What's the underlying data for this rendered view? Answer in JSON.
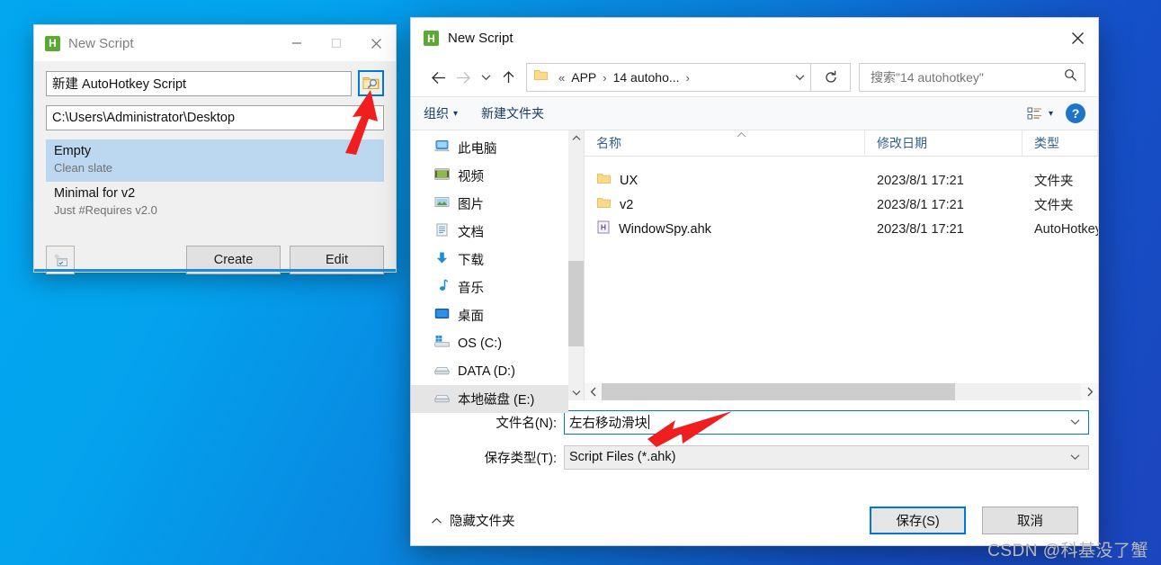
{
  "desktop": {
    "watermark": "CSDN @科基没了蟹"
  },
  "script_window": {
    "title": "New Script",
    "app_icon": "H",
    "caption": {
      "minimize": "minimize-icon",
      "maximize": "maximize-icon",
      "close": "close-icon"
    },
    "name_field": {
      "value": "新建 AutoHotkey Script"
    },
    "browse_button": {
      "icon": "folder-search-icon"
    },
    "path_field": {
      "value": "C:\\Users\\Administrator\\Desktop"
    },
    "templates": [
      {
        "title": "Empty",
        "subtitle": "Clean slate",
        "selected": true
      },
      {
        "title": "Minimal for v2",
        "subtitle": "Just #Requires v2.0",
        "selected": false
      }
    ],
    "small_button": {
      "icon": "script-window-icon"
    },
    "create_button": "Create",
    "edit_button": "Edit"
  },
  "save_dialog": {
    "title": "New Script",
    "app_icon": "H",
    "close_button": "close-icon",
    "nav": {
      "back": "back-arrow-icon",
      "forward": "forward-arrow-icon",
      "recent": "chevron-down-icon",
      "up": "up-arrow-icon",
      "breadcrumb": {
        "overflow": "«",
        "segments": [
          "APP",
          "14 autoho..."
        ],
        "separator": "›",
        "dropdown": "chevron-down-icon"
      },
      "refresh": "refresh-icon",
      "search": {
        "placeholder": "搜索\"14 autohotkey\"",
        "value": "",
        "icon": "search-icon"
      }
    },
    "command_bar": {
      "organize": "组织",
      "organize_caret": "▾",
      "new_folder": "新建文件夹",
      "view_icon": "list-view-icon",
      "view_caret": "▾",
      "help": "?"
    },
    "tree": [
      {
        "label": "此电脑",
        "icon": "computer-icon",
        "selected": false
      },
      {
        "label": "视频",
        "icon": "videos-icon",
        "selected": false
      },
      {
        "label": "图片",
        "icon": "pictures-icon",
        "selected": false
      },
      {
        "label": "文档",
        "icon": "documents-icon",
        "selected": false
      },
      {
        "label": "下载",
        "icon": "downloads-icon",
        "selected": false
      },
      {
        "label": "音乐",
        "icon": "music-icon",
        "selected": false
      },
      {
        "label": "桌面",
        "icon": "desktop-icon",
        "selected": false
      },
      {
        "label": "OS (C:)",
        "icon": "windows-drive-icon",
        "selected": false
      },
      {
        "label": "DATA (D:)",
        "icon": "drive-icon",
        "selected": false
      },
      {
        "label": "本地磁盘 (E:)",
        "icon": "drive-icon",
        "selected": true
      }
    ],
    "columns": [
      "名称",
      "修改日期",
      "类型"
    ],
    "files": [
      {
        "name": "UX",
        "icon": "folder-icon",
        "modified": "2023/8/1 17:21",
        "type": "文件夹"
      },
      {
        "name": "v2",
        "icon": "folder-icon",
        "modified": "2023/8/1 17:21",
        "type": "文件夹"
      },
      {
        "name": "WindowSpy.ahk",
        "icon": "ahk-file-icon",
        "modified": "2023/8/1 17:21",
        "type": "AutoHotkey Script"
      }
    ],
    "filename": {
      "label": "文件名(N):",
      "mnemonic": "N",
      "value": "左右移动滑块"
    },
    "filetype": {
      "label": "保存类型(T):",
      "mnemonic": "T",
      "value": "Script Files (*.ahk)"
    },
    "hide_folders": {
      "label": "隐藏文件夹",
      "icon": "chevron-up-icon"
    },
    "save_button": {
      "label": "保存(S)",
      "mnemonic": "S"
    },
    "cancel_button": {
      "label": "取消"
    }
  },
  "annotations": {
    "arrow_browse": "red-arrow-pointing-to-browse-button",
    "arrow_filename": "red-arrow-pointing-to-filename-field"
  },
  "colors": {
    "accent": "#0078d7",
    "selection": "#bcd8f0",
    "arrow": "#ff1c1c",
    "ahk_green": "#5ba832"
  }
}
